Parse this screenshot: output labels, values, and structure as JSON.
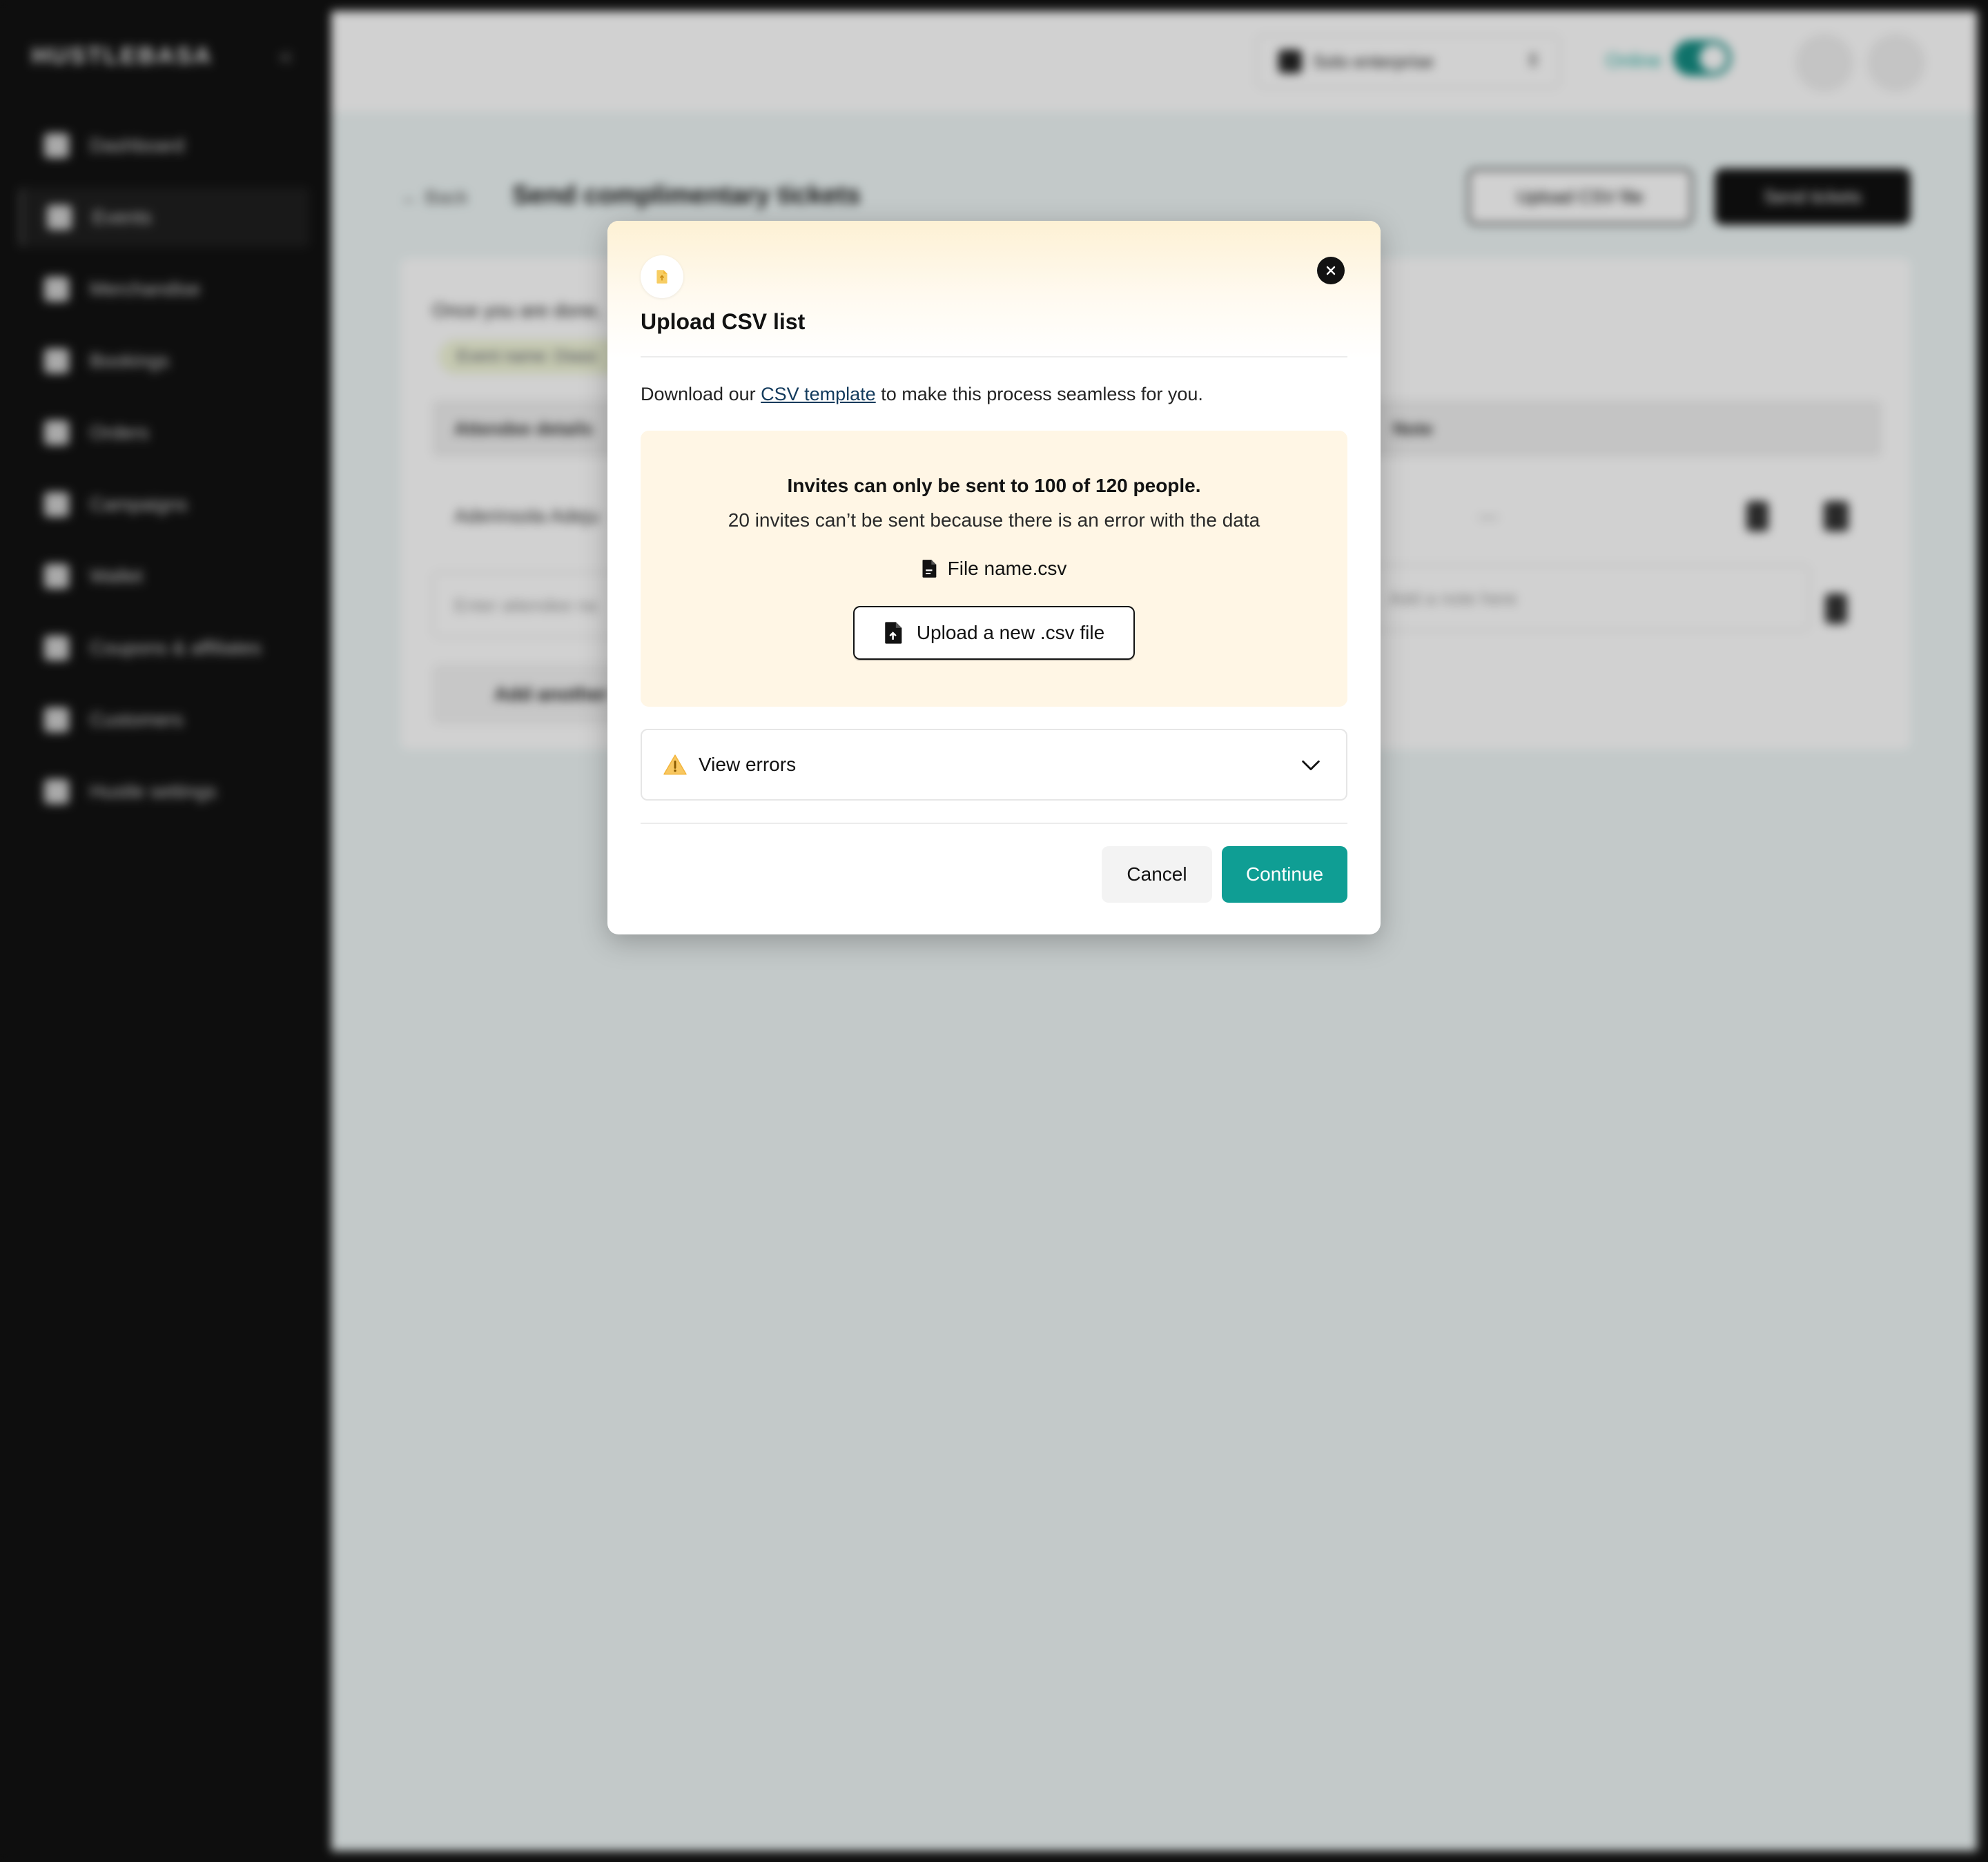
{
  "sidebar": {
    "brand": "HUSTLEBASA",
    "items": [
      {
        "label": "Dashboard"
      },
      {
        "label": "Events"
      },
      {
        "label": "Merchandise"
      },
      {
        "label": "Bookings"
      },
      {
        "label": "Orders"
      },
      {
        "label": "Campaigns"
      },
      {
        "label": "Wallet"
      },
      {
        "label": "Coupons & affiliates"
      },
      {
        "label": "Customers"
      },
      {
        "label": "Hustle settings"
      }
    ]
  },
  "topbar": {
    "business": "Solo enterprise",
    "status": "Online"
  },
  "page": {
    "back": "← Back",
    "title": "Send complimentary tickets",
    "upload_csv": "Upload CSV file",
    "send_tickets": "Send tickets",
    "card_text": "Once you are done,",
    "chip": "Event name: Diaso",
    "col_attendee": "Attendee details",
    "col_note": "Note",
    "row_name": "Aderinsola Adeju",
    "row_dash": "—",
    "attendee_placeholder": "Enter attendee na",
    "note_placeholder": "Add a note here",
    "add_another": "Add another"
  },
  "modal": {
    "title": "Upload CSV list",
    "intro_before": "Download our ",
    "intro_link": "CSV template",
    "intro_after": " to make this process seamless for you.",
    "warning_head": "Invites can only be sent to 100 of 120 people.",
    "warning_sub": "20 invites can’t be sent because there is an error with the data",
    "file_name": "File name.csv",
    "upload_new": "Upload a new .csv file",
    "view_errors": "View errors",
    "cancel": "Cancel",
    "continue": "Continue"
  },
  "colors": {
    "accent": "#0f9e94",
    "warning_bg": "#fff6e5",
    "dark": "#121212"
  }
}
